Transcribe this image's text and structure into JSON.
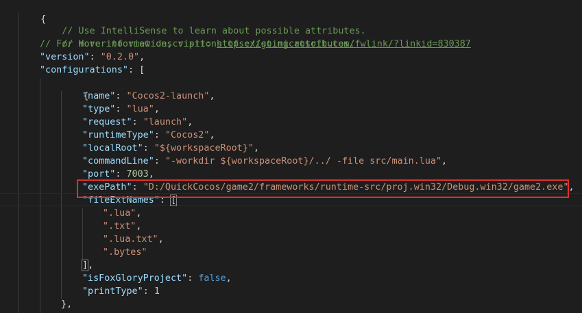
{
  "code": {
    "open_brace": "{",
    "comments": [
      "// Use IntelliSense to learn about possible attributes.",
      "// Hover to view descriptions of existing attributes.",
      "// For more information, visit: "
    ],
    "comment_link": "https://go.microsoft.com/fwlink/?linkid=830387",
    "version_key": "\"version\"",
    "version_value": "\"0.2.0\"",
    "configurations_key": "\"configurations\"",
    "config_open_bracket": "[",
    "config_object_open": "{",
    "properties": [
      {
        "key": "\"name\"",
        "value": "\"Cocos2-launch\""
      },
      {
        "key": "\"type\"",
        "value": "\"lua\""
      },
      {
        "key": "\"request\"",
        "value": "\"launch\""
      },
      {
        "key": "\"runtimeType\"",
        "value": "\"Cocos2\""
      },
      {
        "key": "\"localRoot\"",
        "value": "\"${workspaceRoot}\""
      },
      {
        "key": "\"commandLine\"",
        "value": "\"-workdir ${workspaceRoot}/../ -file src/main.lua\""
      },
      {
        "key": "\"port\"",
        "value": "7003"
      },
      {
        "key": "\"exePath\"",
        "value": "\"D:/QuickCocos/game2/frameworks/runtime-src/proj.win32/Debug.win32/game2.exe\""
      }
    ],
    "file_ext_names_key": "\"fileExtNames\"",
    "file_ext_open_bracket": "[",
    "file_ext_values": [
      "\".lua\"",
      "\".txt\"",
      "\".lua.txt\"",
      "\".bytes\""
    ],
    "file_ext_close_bracket": "]",
    "fox_glory_key": "\"isFoxGloryProject\"",
    "fox_glory_value": "false",
    "print_type_key": "\"printType\"",
    "print_type_value": "1",
    "config_object_close": "}",
    "punct": {
      "colon": ": ",
      "comma": ",",
      "colon_space": ": "
    }
  },
  "colors": {
    "background": "#1e1e1e",
    "comment": "#6a9955",
    "key": "#9cdcfe",
    "string": "#ce9178",
    "number": "#b5cea8",
    "keyword": "#569cd6",
    "highlight_border": "#e0302b"
  }
}
